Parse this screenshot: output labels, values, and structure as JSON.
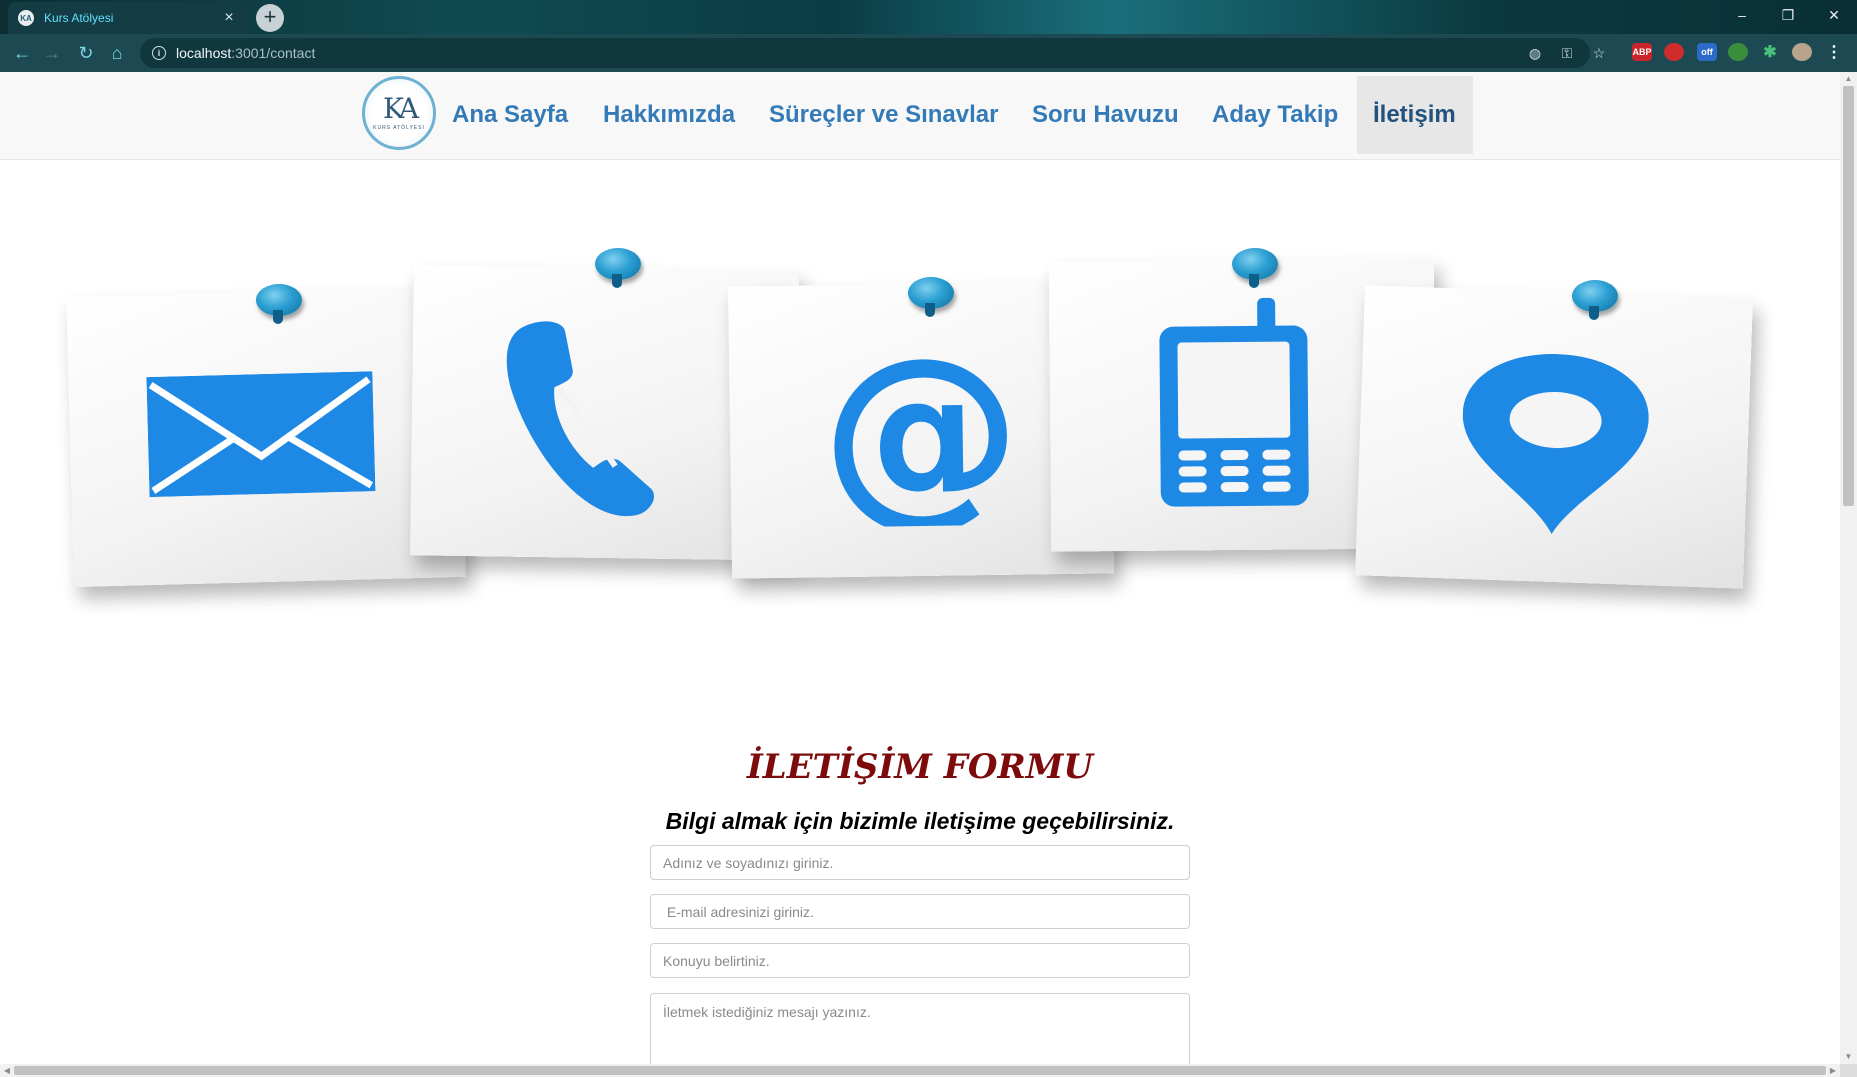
{
  "browser": {
    "tab_title": "Kurs Atölyesi",
    "tab_favicon_text": "KA",
    "tab_close": "×",
    "new_tab": "+",
    "url_host": "localhost",
    "url_rest": ":3001/contact",
    "extensions": [
      "ABP",
      "off"
    ],
    "window_controls": [
      "–",
      "❐",
      "✕"
    ]
  },
  "navbar": {
    "brand_mark": "KA",
    "brand_sub": "KURS ATÖLYESİ",
    "links": [
      {
        "label": "Ana Sayfa",
        "active": false
      },
      {
        "label": "Hakkımızda",
        "active": false
      },
      {
        "label": "Süreçler ve Sınavlar",
        "active": false
      },
      {
        "label": "Soru Havuzu",
        "active": false
      },
      {
        "label": "Aday Takip",
        "active": false
      },
      {
        "label": "İletişim",
        "active": true
      }
    ]
  },
  "hero": {
    "icons": [
      "envelope-icon",
      "phone-icon",
      "at-sign-icon",
      "mobile-phone-icon",
      "location-pin-icon"
    ],
    "icon_color": "#1e88e5",
    "pin_color": "#2a9ed2"
  },
  "contact_form": {
    "title": "İLETİŞİM FORMU",
    "subtitle": "Bilgi almak için bizimle iletişime geçebilirsiniz.",
    "name_placeholder": "Adınız ve soyadınızı giriniz.",
    "email_placeholder": " E-mail adresinizi giriniz.",
    "subject_placeholder": "Konuyu belirtiniz.",
    "message_placeholder": "İletmek istediğiniz mesajı yazınız."
  },
  "colors": {
    "link": "#337ab7",
    "active_link": "#23527c",
    "form_title": "#7d0b0b"
  }
}
